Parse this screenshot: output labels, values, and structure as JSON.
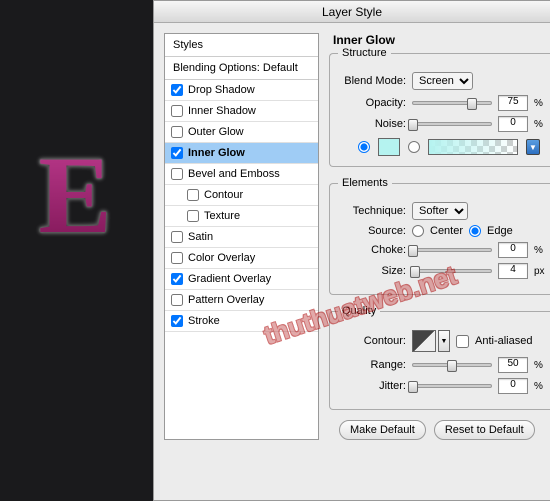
{
  "dialog": {
    "title": "Layer Style"
  },
  "styles": {
    "header": "Styles",
    "blending": "Blending Options: Default",
    "items": [
      {
        "label": "Drop Shadow",
        "checked": true
      },
      {
        "label": "Inner Shadow",
        "checked": false
      },
      {
        "label": "Outer Glow",
        "checked": false
      },
      {
        "label": "Inner Glow",
        "checked": true,
        "selected": true
      },
      {
        "label": "Bevel and Emboss",
        "checked": false
      },
      {
        "label": "Contour",
        "checked": false,
        "indent": true
      },
      {
        "label": "Texture",
        "checked": false,
        "indent": true
      },
      {
        "label": "Satin",
        "checked": false
      },
      {
        "label": "Color Overlay",
        "checked": false
      },
      {
        "label": "Gradient Overlay",
        "checked": true
      },
      {
        "label": "Pattern Overlay",
        "checked": false
      },
      {
        "label": "Stroke",
        "checked": true
      }
    ]
  },
  "panel": {
    "title": "Inner Glow",
    "structure": {
      "legend": "Structure",
      "blend_mode_label": "Blend Mode:",
      "blend_mode_value": "Screen",
      "opacity_label": "Opacity:",
      "opacity_value": "75",
      "opacity_unit": "%",
      "noise_label": "Noise:",
      "noise_value": "0",
      "noise_unit": "%",
      "color_radio": "color",
      "swatch_color": "#b5f3f0"
    },
    "elements": {
      "legend": "Elements",
      "technique_label": "Technique:",
      "technique_value": "Softer",
      "source_label": "Source:",
      "source_center": "Center",
      "source_edge": "Edge",
      "source_value": "Edge",
      "choke_label": "Choke:",
      "choke_value": "0",
      "choke_unit": "%",
      "size_label": "Size:",
      "size_value": "4",
      "size_unit": "px"
    },
    "quality": {
      "legend": "Quality",
      "contour_label": "Contour:",
      "anti_alias": "Anti-aliased",
      "range_label": "Range:",
      "range_value": "50",
      "range_unit": "%",
      "jitter_label": "Jitter:",
      "jitter_value": "0",
      "jitter_unit": "%"
    }
  },
  "buttons": {
    "make_default": "Make Default",
    "reset": "Reset to Default"
  },
  "preview_letter": "E",
  "watermark": "thuthuatweb.net"
}
